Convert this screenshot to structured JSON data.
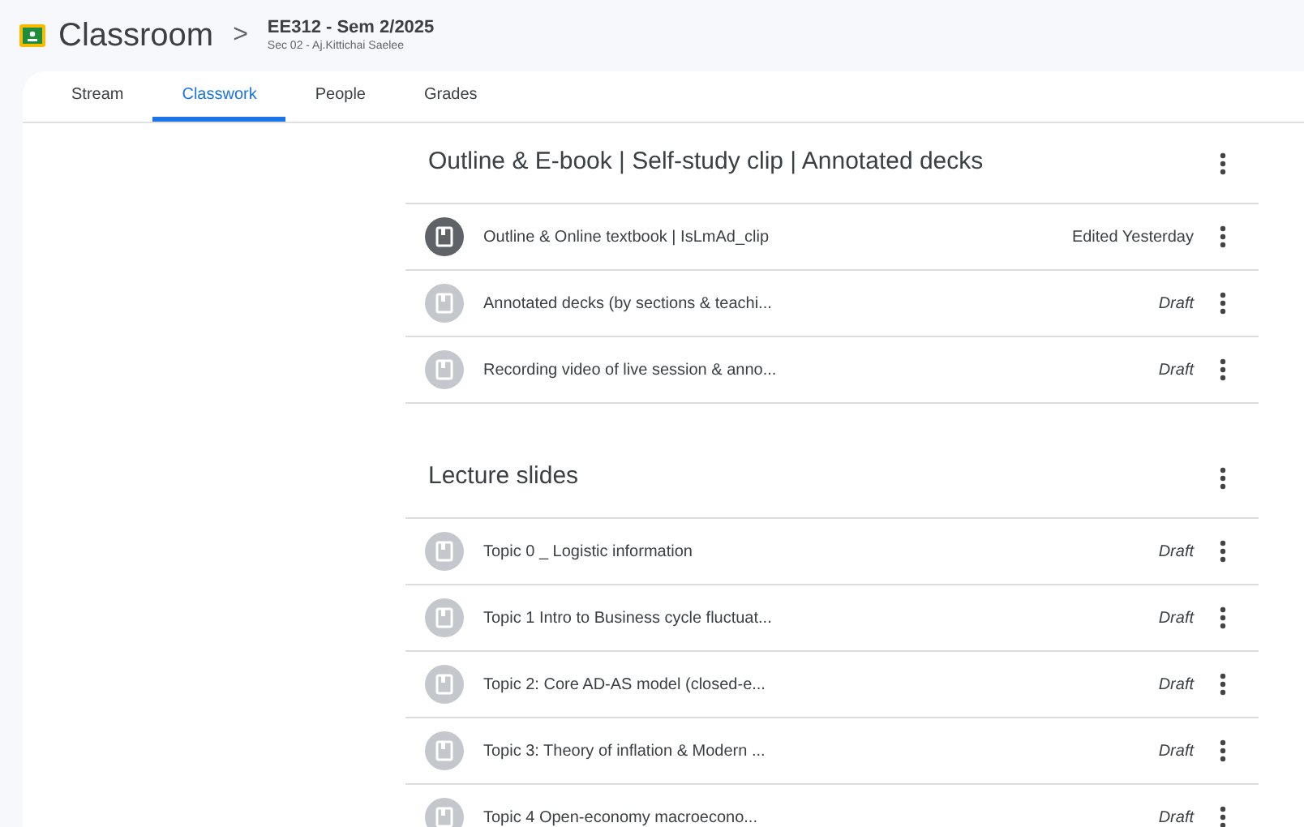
{
  "header": {
    "app_name": "Classroom",
    "separator": ">",
    "class_title": "EE312 - Sem 2/2025",
    "class_subtitle": "Sec 02 - Aj.Kittichai Saelee"
  },
  "tabs": [
    {
      "label": "Stream",
      "selected": false
    },
    {
      "label": "Classwork",
      "selected": true
    },
    {
      "label": "People",
      "selected": false
    },
    {
      "label": "Grades",
      "selected": false
    }
  ],
  "topics": [
    {
      "title": "Outline & E-book | Self-study clip | Annotated decks",
      "materials": [
        {
          "title": "Outline & Online textbook | IsLmAd_clip",
          "status": "Edited Yesterday",
          "published": true
        },
        {
          "title": "Annotated decks (by sections & teachi...",
          "status": "Draft",
          "published": false
        },
        {
          "title": "Recording video of live session & anno...",
          "status": "Draft",
          "published": false
        }
      ]
    },
    {
      "title": "Lecture slides",
      "materials": [
        {
          "title": "Topic 0 _ Logistic information",
          "status": "Draft",
          "published": false
        },
        {
          "title": "Topic 1 Intro to Business cycle fluctuat...",
          "status": "Draft",
          "published": false
        },
        {
          "title": "Topic 2: Core AD-AS model (closed-e...",
          "status": "Draft",
          "published": false
        },
        {
          "title": "Topic 3: Theory of inflation & Modern ...",
          "status": "Draft",
          "published": false
        },
        {
          "title": "Topic 4 Open-economy macroecono...",
          "status": "Draft",
          "published": false
        }
      ]
    }
  ]
}
